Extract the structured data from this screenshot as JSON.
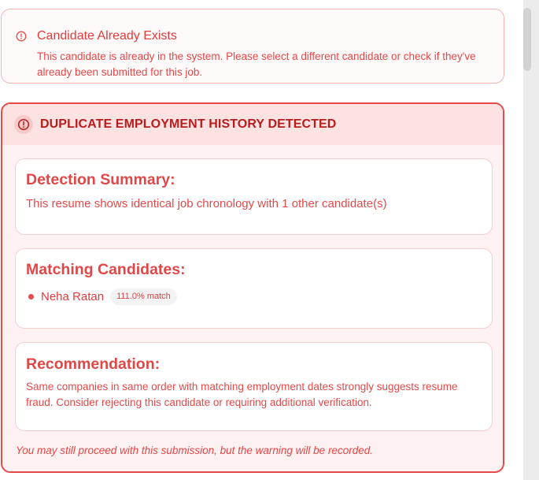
{
  "alert": {
    "title": "Candidate Already Exists",
    "description": "This candidate is already in the system. Please select a different candidate or check if they've already been submitted for this job."
  },
  "duplicate": {
    "header_title": "DUPLICATE EMPLOYMENT HISTORY DETECTED",
    "summary": {
      "title": "Detection Summary:",
      "text": "This resume shows identical job chronology with 1 other candidate(s)"
    },
    "matching": {
      "title": "Matching Candidates:",
      "candidates": [
        {
          "name": "Neha Ratan",
          "match": "111.0% match"
        }
      ]
    },
    "recommendation": {
      "title": "Recommendation:",
      "text": "Same companies in same order with matching employment dates strongly suggests resume fraud. Consider rejecting this candidate or requiring additional verification."
    },
    "footer_note": "You may still proceed with this submission, but the warning will be recorded."
  },
  "colors": {
    "accent_red": "#e44b4b",
    "header_red": "#b91c1c",
    "header_bg": "#fde2e2",
    "panel_bg": "#fdf1f1"
  },
  "icons": {
    "alert_icon": "alert-circle-icon",
    "header_icon": "alert-circle-icon"
  }
}
